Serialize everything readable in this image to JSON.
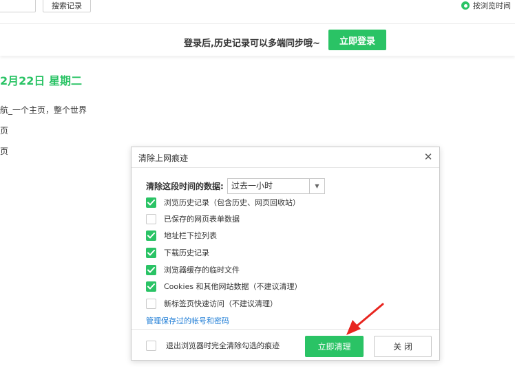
{
  "toolbar": {
    "search_button_label": "搜索记录",
    "sort_option_label": "按浏览时间"
  },
  "login_bar": {
    "message": "登录后,历史记录可以多端同步哦~",
    "login_button": "立即登录"
  },
  "history": {
    "date_heading": "2月22日 星期二",
    "items": [
      "航_一个主页，整个世界",
      "页",
      "页"
    ]
  },
  "dialog": {
    "title": "清除上网痕迹",
    "close_icon": "close-icon",
    "range_label": "清除这段时间的数据:",
    "range_value": "过去一小时",
    "options": [
      {
        "label": "浏览历史记录（包含历史、网页回收站）",
        "checked": true
      },
      {
        "label": "已保存的网页表单数据",
        "checked": false
      },
      {
        "label": "地址栏下拉列表",
        "checked": true
      },
      {
        "label": "下载历史记录",
        "checked": true
      },
      {
        "label": "浏览器缓存的临时文件",
        "checked": true
      },
      {
        "label": "Cookies 和其他网站数据（不建议清理）",
        "checked": true
      },
      {
        "label": "新标签页快速访问（不建议清理）",
        "checked": false
      }
    ],
    "manage_link": "管理保存过的帐号和密码",
    "exit_option": {
      "label": "退出浏览器时完全清除勾选的痕迹",
      "checked": false
    },
    "clear_button": "立即清理",
    "cancel_button": "关 闭"
  },
  "colors": {
    "accent": "#2ac365",
    "link": "#1f7dd6",
    "annotation_arrow": "#e8251f"
  }
}
